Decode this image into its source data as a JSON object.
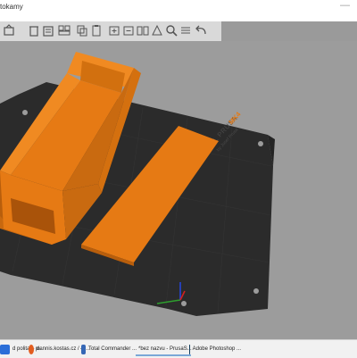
{
  "window": {
    "title_fragment": "tokamy"
  },
  "toolbar": {
    "buttons": [
      "add-icon",
      "delete-icon",
      "delete-all-icon",
      "arrange-icon",
      "copy-icon",
      "paste-icon",
      "add-instance-icon",
      "remove-instance-icon",
      "split-objects-icon",
      "split-parts-icon",
      "search-icon",
      "layers-icon",
      "undo-icon"
    ]
  },
  "bed": {
    "brand_line1": "ORIGINAL PRUSA",
    "brand_line2": "MK4",
    "brand_line3": "by Josef Prusa",
    "colors": {
      "plate": "#2a2a2a",
      "model": "#e67a14",
      "model_shadow": "#b85e0c",
      "model_edge": "#f08a22"
    }
  },
  "taskbar": {
    "items": [
      {
        "label": "d polita – p...",
        "icon_color": "#2b6ed8"
      },
      {
        "label": "dennis.kostas.cz / 4i...",
        "icon_color": "#e25d1f"
      },
      {
        "label": "Total Commander ...",
        "icon_color": "#3567b5"
      },
      {
        "label": "*bez nazvu - PrusaS...",
        "icon_color": "#1d1d1d"
      },
      {
        "label": "Adobe Photoshop ...",
        "icon_color": "#0e3a5a"
      }
    ]
  }
}
